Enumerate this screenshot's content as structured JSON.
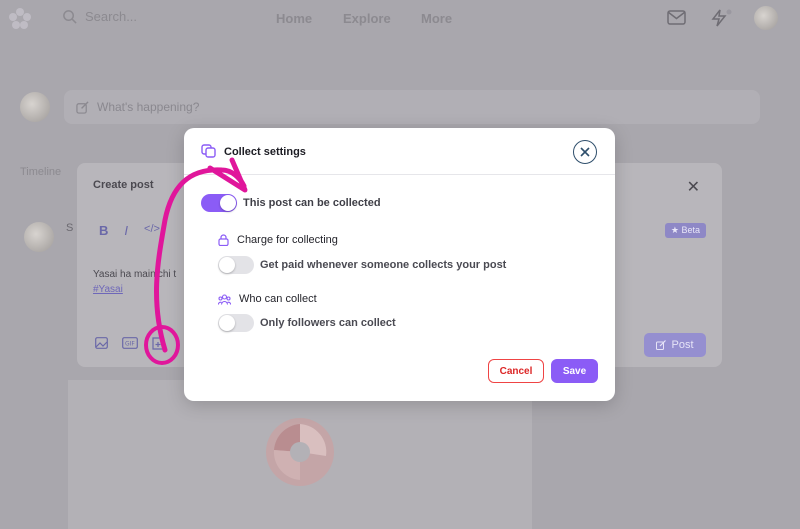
{
  "topbar": {
    "search_placeholder": "Search...",
    "nav": [
      "Home",
      "Explore",
      "More"
    ]
  },
  "compose": {
    "placeholder": "What's happening?"
  },
  "background_tab_label": "Timeline",
  "create_post": {
    "title": "Create post",
    "author_initial": "S",
    "toolbar": {
      "bold": "B",
      "italic": "I",
      "code": "</>"
    },
    "beta_label": "★ Beta",
    "body_text": "Yasai ha mainichi t",
    "hashtag": "#Yasai",
    "post_button": "Post"
  },
  "modal": {
    "title": "Collect settings",
    "collectable": {
      "label": "This post can be collected",
      "enabled": true
    },
    "charge": {
      "heading": "Charge for collecting",
      "toggle_label": "Get paid whenever someone collects your post",
      "enabled": false
    },
    "who": {
      "heading": "Who can collect",
      "toggle_label": "Only followers can collect",
      "enabled": false
    },
    "cancel": "Cancel",
    "save": "Save"
  },
  "colors": {
    "accent": "#8b5cf6",
    "cancel": "#dc2626",
    "annotation": "#e0169b",
    "overlay": "#a9a7ad"
  },
  "icons": {
    "header": "collect-icon",
    "charge": "lock-icon",
    "who": "users-icon",
    "close": "close-icon"
  }
}
